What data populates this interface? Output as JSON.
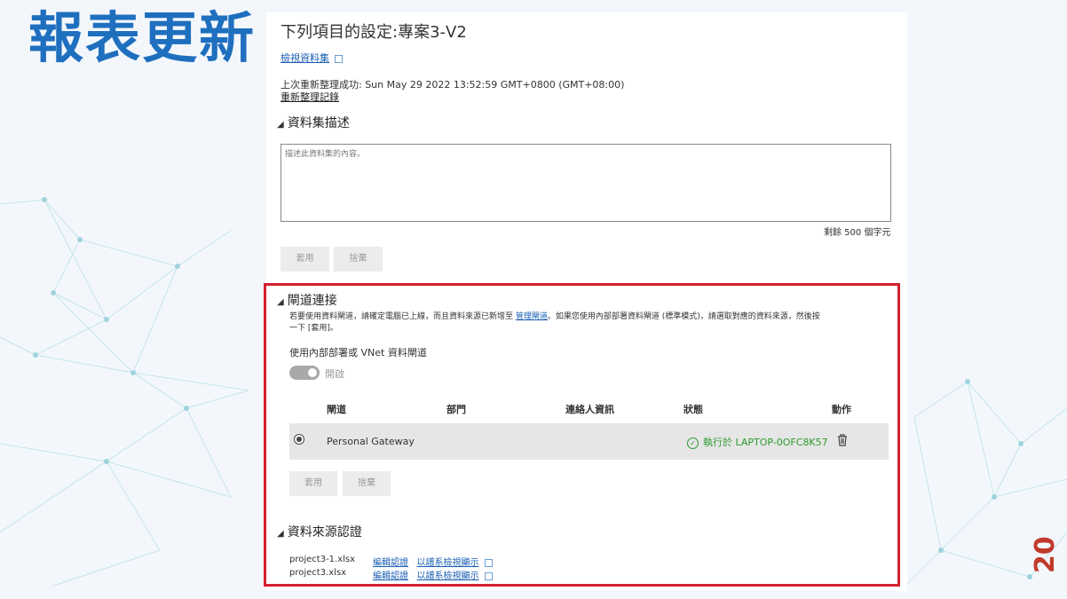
{
  "slide": {
    "title": "報表更新",
    "page_number": "20"
  },
  "settings": {
    "title": "下列項目的設定:專案3-V2",
    "view_dataset_link": "檢視資料集",
    "last_refresh": "上次重新整理成功: Sun May 29 2022 13:52:59 GMT+0800 (GMT+08:00)",
    "refresh_history_link": "重新整理記錄"
  },
  "description": {
    "section_title": "資料集描述",
    "placeholder": "描述此資料集的內容。",
    "remaining": "剩餘 500 個字元",
    "apply_label": "套用",
    "discard_label": "捨棄"
  },
  "gateway": {
    "section_title": "閘道連接",
    "info_line1_prefix": "若要使用資料閘道，請確定電腦已上線，而且資料來源已新增至 ",
    "info_link": "管理閘道",
    "info_line1_suffix": "。如果您使用內部部署資料閘道 (標準模式)，請選取對應的資料來源，然後按",
    "info_line2": "一下 [套用]。",
    "toggle_caption": "使用內部部署或 VNet 資料閘道",
    "toggle_state": "開啟",
    "columns": [
      "閘道",
      "部門",
      "連絡人資訊",
      "狀態",
      "動作"
    ],
    "row": {
      "name": "Personal Gateway",
      "status": "執行於 LAPTOP-0OFC8K57"
    },
    "apply_label": "套用",
    "discard_label": "捨棄"
  },
  "credentials": {
    "section_title": "資料來源認證",
    "items": [
      {
        "file": "project3-1.xlsx",
        "edit_link": "編輯認證",
        "view_link": "以譜系檢視顯示"
      },
      {
        "file": "project3.xlsx",
        "edit_link": "編輯認證",
        "view_link": "以譜系檢視顯示"
      }
    ]
  },
  "colors": {
    "title_blue": "#1f6fbf",
    "highlight_red": "#d3202f",
    "status_green": "#2c9a2c",
    "link_blue": "#1a5fb4"
  },
  "icons": [
    "external-link-icon",
    "collapse-triangle-icon",
    "radio-selected-icon",
    "check-circle-icon",
    "trash-icon"
  ]
}
